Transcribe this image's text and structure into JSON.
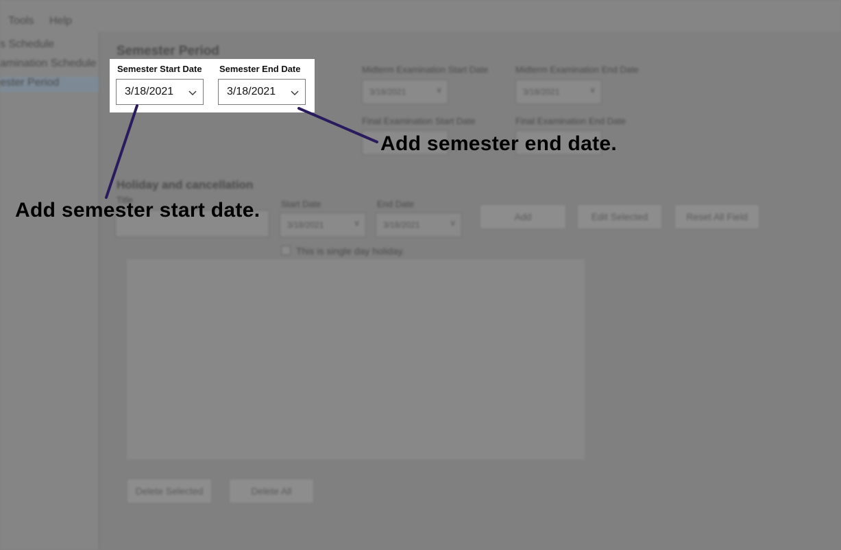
{
  "menu": {
    "tools": "Tools",
    "help": "Help"
  },
  "sidebar": {
    "items": [
      {
        "label": "s Schedule"
      },
      {
        "label": "amination Schedule"
      },
      {
        "label": "ester Period"
      }
    ]
  },
  "semester_period": {
    "title": "Semester Period",
    "start_label": "Semester Start Date",
    "start_value": "3/18/2021",
    "end_label": "Semester End Date",
    "end_value": "3/18/2021",
    "midterm_start_label": "Midterm Examination Start Date",
    "midterm_start_value": "3/18/2021",
    "midterm_end_label": "Midterm Examination End Date",
    "midterm_end_value": "3/18/2021",
    "final_start_label": "Final Examination Start Date",
    "final_end_label": "Final Examination End Date"
  },
  "holiday": {
    "title": "Holiday and cancellation",
    "title_field_label": "Title",
    "start_label": "Start Date",
    "start_value": "3/18/2021",
    "end_label": "End Date",
    "end_value": "3/18/2021",
    "add_button": "Add",
    "edit_button": "Edit Selected",
    "reset_button": "Reset All Field",
    "single_day_label": "This is single day holiday.",
    "delete_selected_button": "Delete Selected",
    "delete_all_button": "Delete All"
  },
  "annotations": {
    "end_date": "Add semester end date.",
    "start_date": "Add semester start date."
  },
  "colors": {
    "callout_line": "#2a1a5e",
    "overlay": "#808080",
    "highlight_bg": "#ffffff"
  }
}
